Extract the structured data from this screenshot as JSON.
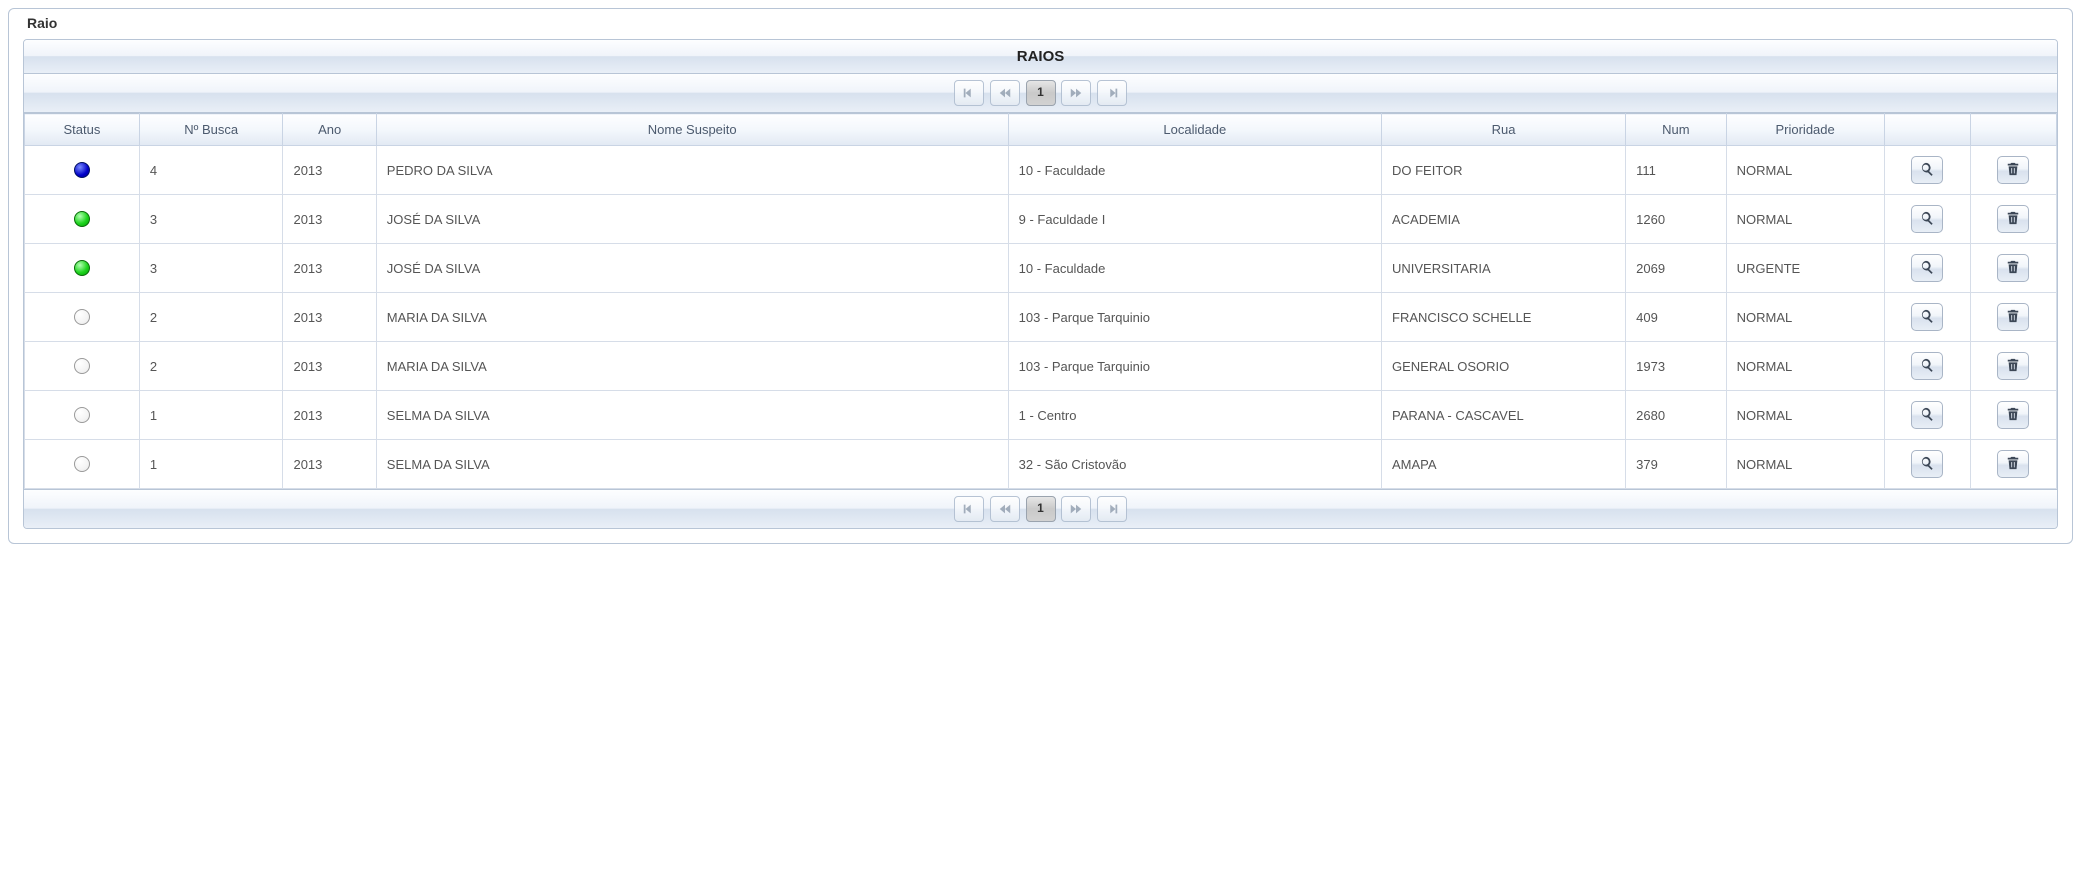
{
  "panel": {
    "title": "Raio"
  },
  "grid": {
    "title": "RAIOS",
    "pagination": {
      "current_page": "1"
    },
    "columns": {
      "status": "Status",
      "n_busca": "Nº Busca",
      "ano": "Ano",
      "nome": "Nome Suspeito",
      "localidade": "Localidade",
      "rua": "Rua",
      "num": "Num",
      "prioridade": "Prioridade",
      "view": "",
      "delete": ""
    },
    "rows": [
      {
        "status": "blue",
        "n_busca": "4",
        "ano": "2013",
        "nome": "PEDRO DA SILVA",
        "localidade": "10 - Faculdade",
        "rua": "DO FEITOR",
        "num": "111",
        "prioridade": "NORMAL"
      },
      {
        "status": "green",
        "n_busca": "3",
        "ano": "2013",
        "nome": "JOSÉ DA SILVA",
        "localidade": "9 - Faculdade I",
        "rua": "ACADEMIA",
        "num": "1260",
        "prioridade": "NORMAL"
      },
      {
        "status": "green",
        "n_busca": "3",
        "ano": "2013",
        "nome": "JOSÉ DA SILVA",
        "localidade": "10 - Faculdade",
        "rua": "UNIVERSITARIA",
        "num": "2069",
        "prioridade": "URGENTE"
      },
      {
        "status": "white",
        "n_busca": "2",
        "ano": "2013",
        "nome": "MARIA DA SILVA",
        "localidade": "103 - Parque Tarquinio",
        "rua": "FRANCISCO SCHELLE",
        "num": "409",
        "prioridade": "NORMAL"
      },
      {
        "status": "white",
        "n_busca": "2",
        "ano": "2013",
        "nome": "MARIA DA SILVA",
        "localidade": "103 - Parque Tarquinio",
        "rua": "GENERAL OSORIO",
        "num": "1973",
        "prioridade": "NORMAL"
      },
      {
        "status": "white",
        "n_busca": "1",
        "ano": "2013",
        "nome": "SELMA DA SILVA",
        "localidade": "1 - Centro",
        "rua": "PARANA - CASCAVEL",
        "num": "2680",
        "prioridade": "NORMAL"
      },
      {
        "status": "white",
        "n_busca": "1",
        "ano": "2013",
        "nome": "SELMA DA SILVA",
        "localidade": "32 - São Cristovão",
        "rua": "AMAPA",
        "num": "379",
        "prioridade": "NORMAL"
      }
    ]
  },
  "icons": {
    "first": "first-page-icon",
    "prev": "previous-page-icon",
    "next": "next-page-icon",
    "last": "last-page-icon",
    "view": "magnifier-icon",
    "delete": "trash-icon"
  }
}
